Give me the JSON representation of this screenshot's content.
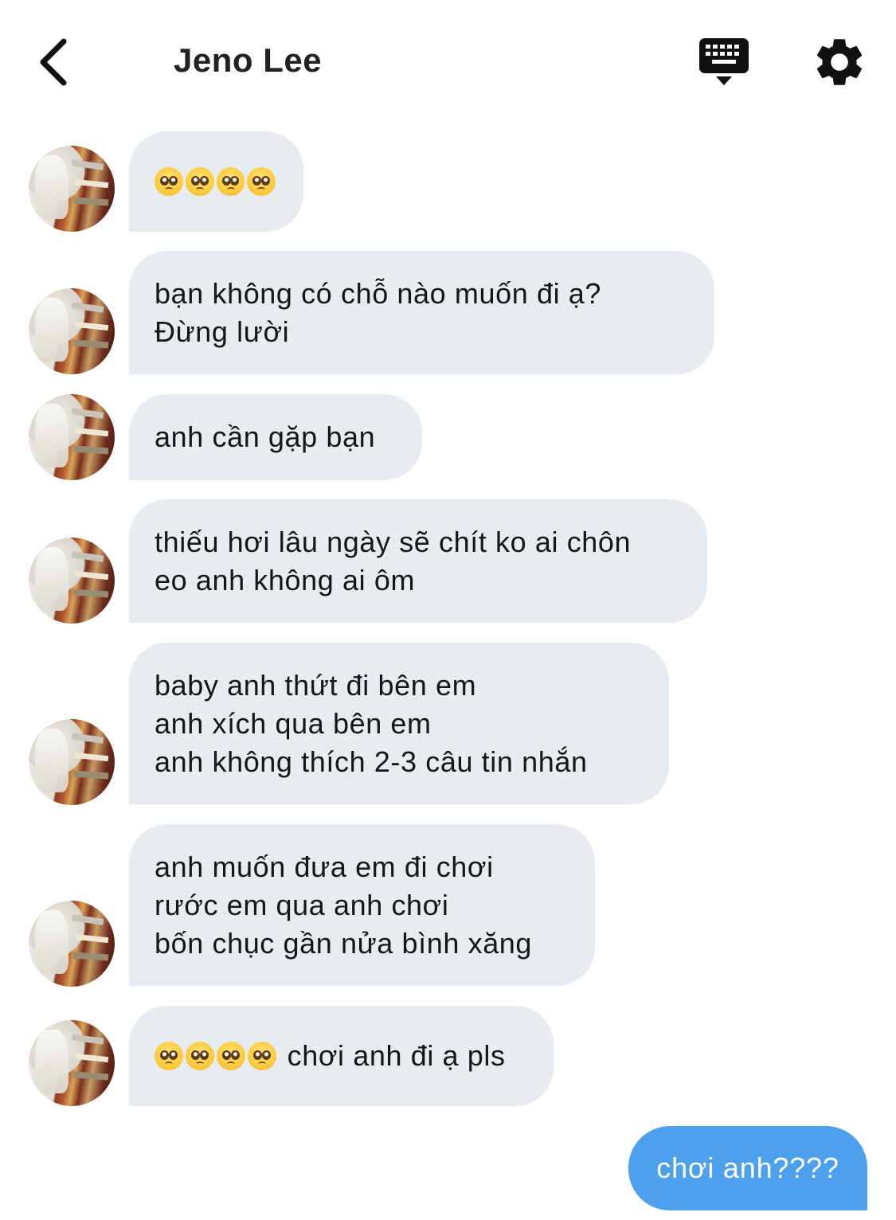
{
  "header": {
    "title": "Jeno Lee",
    "back_icon": "chevron-left-icon",
    "keyboard_icon": "keyboard-icon",
    "settings_icon": "gear-icon"
  },
  "messages": [
    {
      "from": "them",
      "emoji_count": 4,
      "text": ""
    },
    {
      "from": "them",
      "text": "bạn không có chỗ nào muốn đi ạ?\nĐừng lười"
    },
    {
      "from": "them",
      "text": "anh cần gặp bạn"
    },
    {
      "from": "them",
      "text": "thiếu hơi lâu ngày sẽ chít ko ai chôn\neo anh không ai ôm"
    },
    {
      "from": "them",
      "text": "baby anh thứt đi bên em\nanh xích qua bên em\nanh không thích 2-3 câu tin nhắn"
    },
    {
      "from": "them",
      "text": "anh muốn đưa em đi chơi\nrước em qua anh chơi\nbốn chục gần nửa bình xăng"
    },
    {
      "from": "them",
      "emoji_count": 4,
      "text": " chơi anh đi ạ pls"
    },
    {
      "from": "me",
      "text": "chơi anh????"
    }
  ],
  "colors": {
    "received_bubble": "#e6ecf0",
    "sent_bubble": "#4da1ec",
    "text": "#14171a"
  }
}
